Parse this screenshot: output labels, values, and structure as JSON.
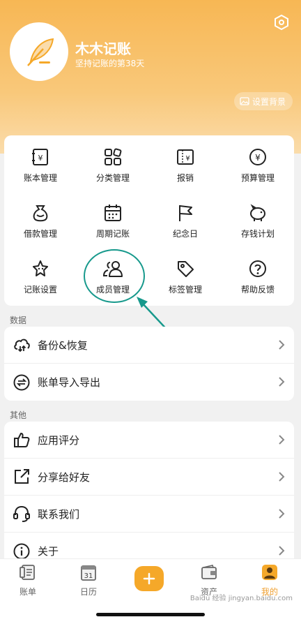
{
  "colors": {
    "accent": "#f5a829",
    "annotation": "#17998c",
    "header_top": "#f7b754"
  },
  "header": {
    "user_name": "木木记账",
    "subtitle": "坚持记账的第38天",
    "set_bg_label": "设置背景"
  },
  "grid": [
    {
      "label": "账本管理",
      "icon": "ledger-icon"
    },
    {
      "label": "分类管理",
      "icon": "category-icon"
    },
    {
      "label": "报销",
      "icon": "reimburse-icon"
    },
    {
      "label": "预算管理",
      "icon": "budget-icon"
    },
    {
      "label": "借款管理",
      "icon": "loan-icon"
    },
    {
      "label": "周期记账",
      "icon": "calendar-icon"
    },
    {
      "label": "纪念日",
      "icon": "flag-icon"
    },
    {
      "label": "存钱计划",
      "icon": "piggy-bank-icon"
    },
    {
      "label": "记账设置",
      "icon": "star-settings-icon"
    },
    {
      "label": "成员管理",
      "icon": "members-icon"
    },
    {
      "label": "标签管理",
      "icon": "tag-icon"
    },
    {
      "label": "帮助反馈",
      "icon": "help-icon"
    }
  ],
  "sections": {
    "data_label": "数据",
    "other_label": "其他"
  },
  "data_list": [
    {
      "label": "备份&恢复",
      "icon": "cloud-sync-icon"
    },
    {
      "label": "账单导入导出",
      "icon": "import-export-icon"
    }
  ],
  "other_list": [
    {
      "label": "应用评分",
      "icon": "thumbs-up-icon"
    },
    {
      "label": "分享给好友",
      "icon": "share-icon"
    },
    {
      "label": "联系我们",
      "icon": "headset-icon"
    },
    {
      "label": "关于",
      "icon": "info-icon"
    }
  ],
  "nav": [
    {
      "label": "账单",
      "icon": "bill-icon"
    },
    {
      "label": "日历",
      "icon": "calendar-day-icon",
      "day": "31"
    },
    {
      "label": "资产",
      "icon": "wallet-icon"
    },
    {
      "label": "我的",
      "icon": "profile-icon"
    }
  ],
  "watermark": "Baidu 经验 jingyan.baidu.com"
}
